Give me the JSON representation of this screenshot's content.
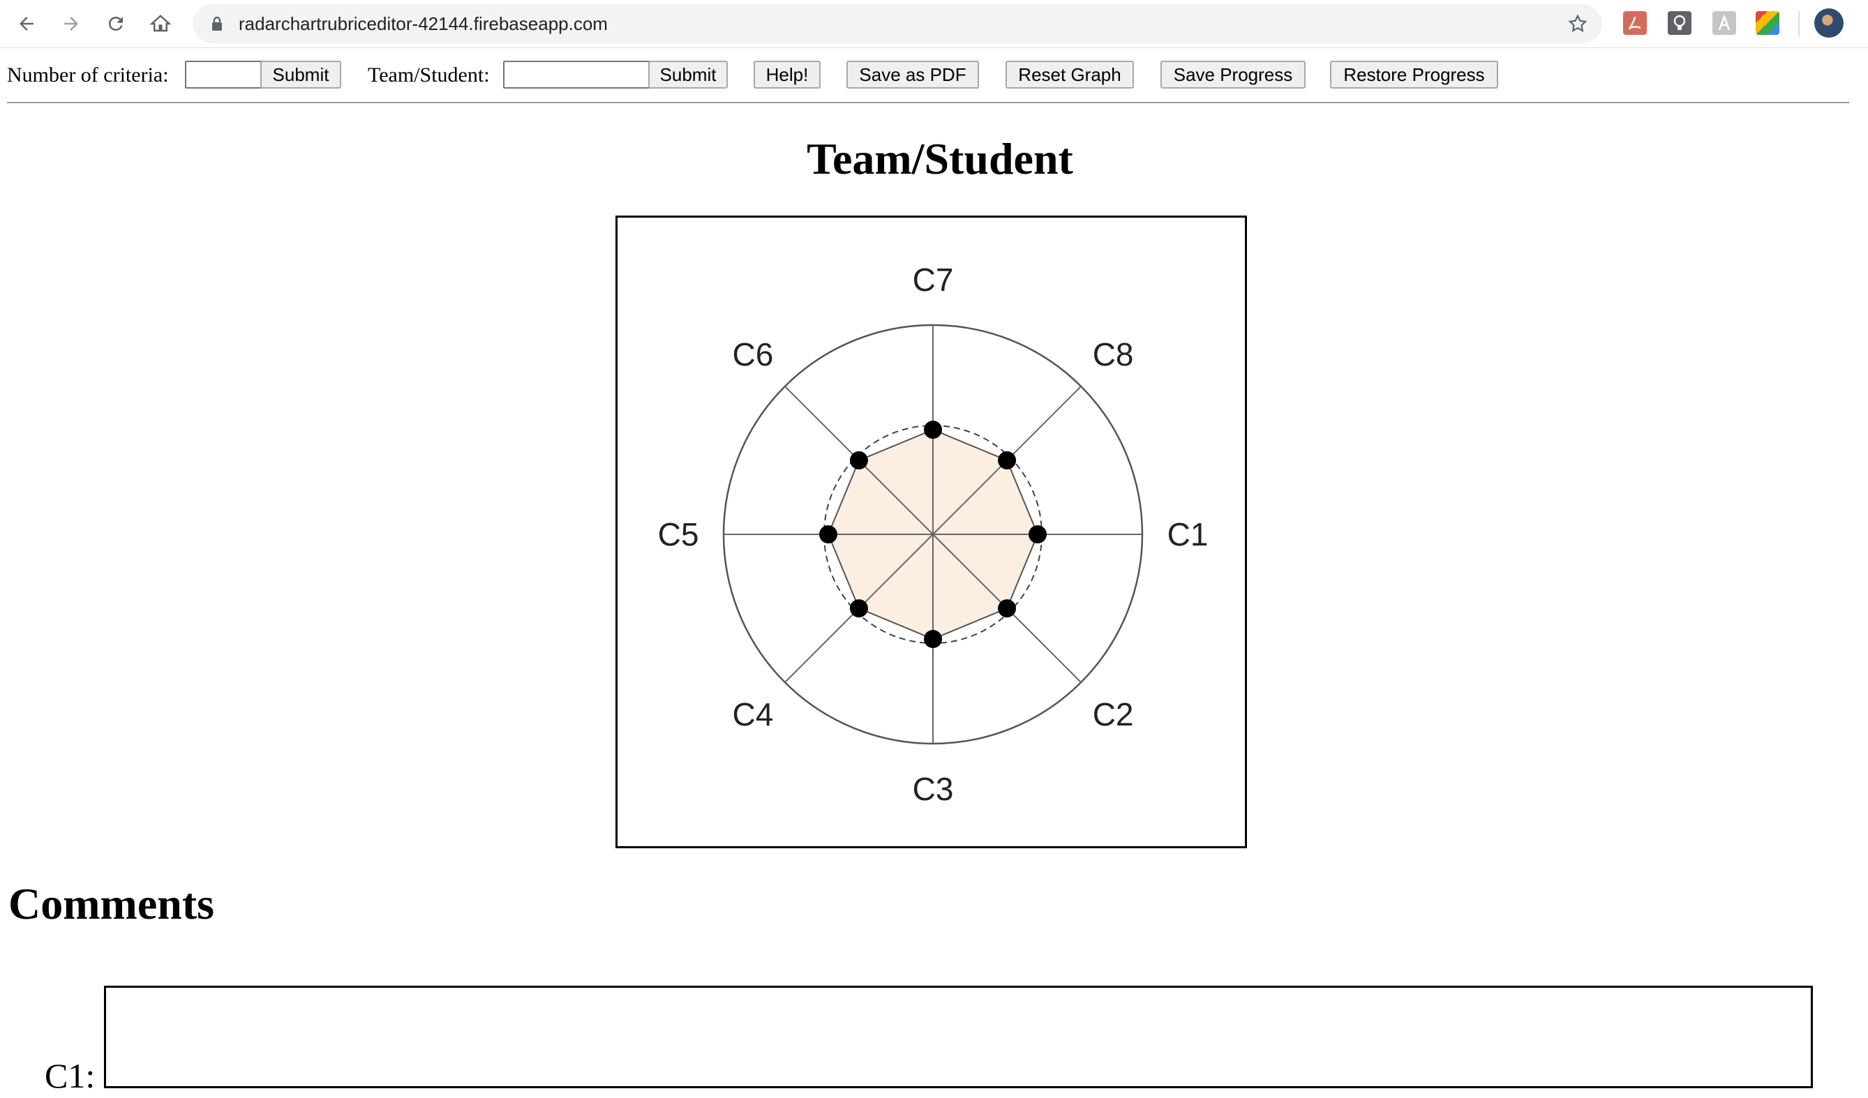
{
  "browser": {
    "url": "radarchartrubriceditor-42144.firebaseapp.com",
    "icons": [
      "back-arrow-icon",
      "forward-arrow-icon",
      "reload-icon",
      "home-icon",
      "lock-icon",
      "bookmark-star-icon",
      "pdf-extension-icon",
      "lightbulb-extension-icon",
      "a-extension-icon",
      "color-extension-icon",
      "profile-avatar"
    ]
  },
  "toolbar": {
    "criteria_label": "Number of criteria:",
    "criteria_value": "",
    "criteria_submit": "Submit",
    "team_label": "Team/Student:",
    "team_value": "",
    "team_submit": "Submit",
    "help": "Help!",
    "save_pdf": "Save as PDF",
    "reset": "Reset Graph",
    "save_progress": "Save Progress",
    "restore_progress": "Restore Progress"
  },
  "page": {
    "title": "Team/Student",
    "comments_heading": "Comments",
    "comment_label": "C1:"
  },
  "chart_data": {
    "type": "radar",
    "categories": [
      "C1",
      "C2",
      "C3",
      "C4",
      "C5",
      "C6",
      "C7",
      "C8"
    ],
    "values": [
      0.5,
      0.5,
      0.5,
      0.5,
      0.5,
      0.5,
      0.5,
      0.5
    ],
    "range": [
      0,
      1
    ],
    "fill_color": "#fdeee2",
    "point_color": "#000000",
    "reference_ring": 0.5
  }
}
